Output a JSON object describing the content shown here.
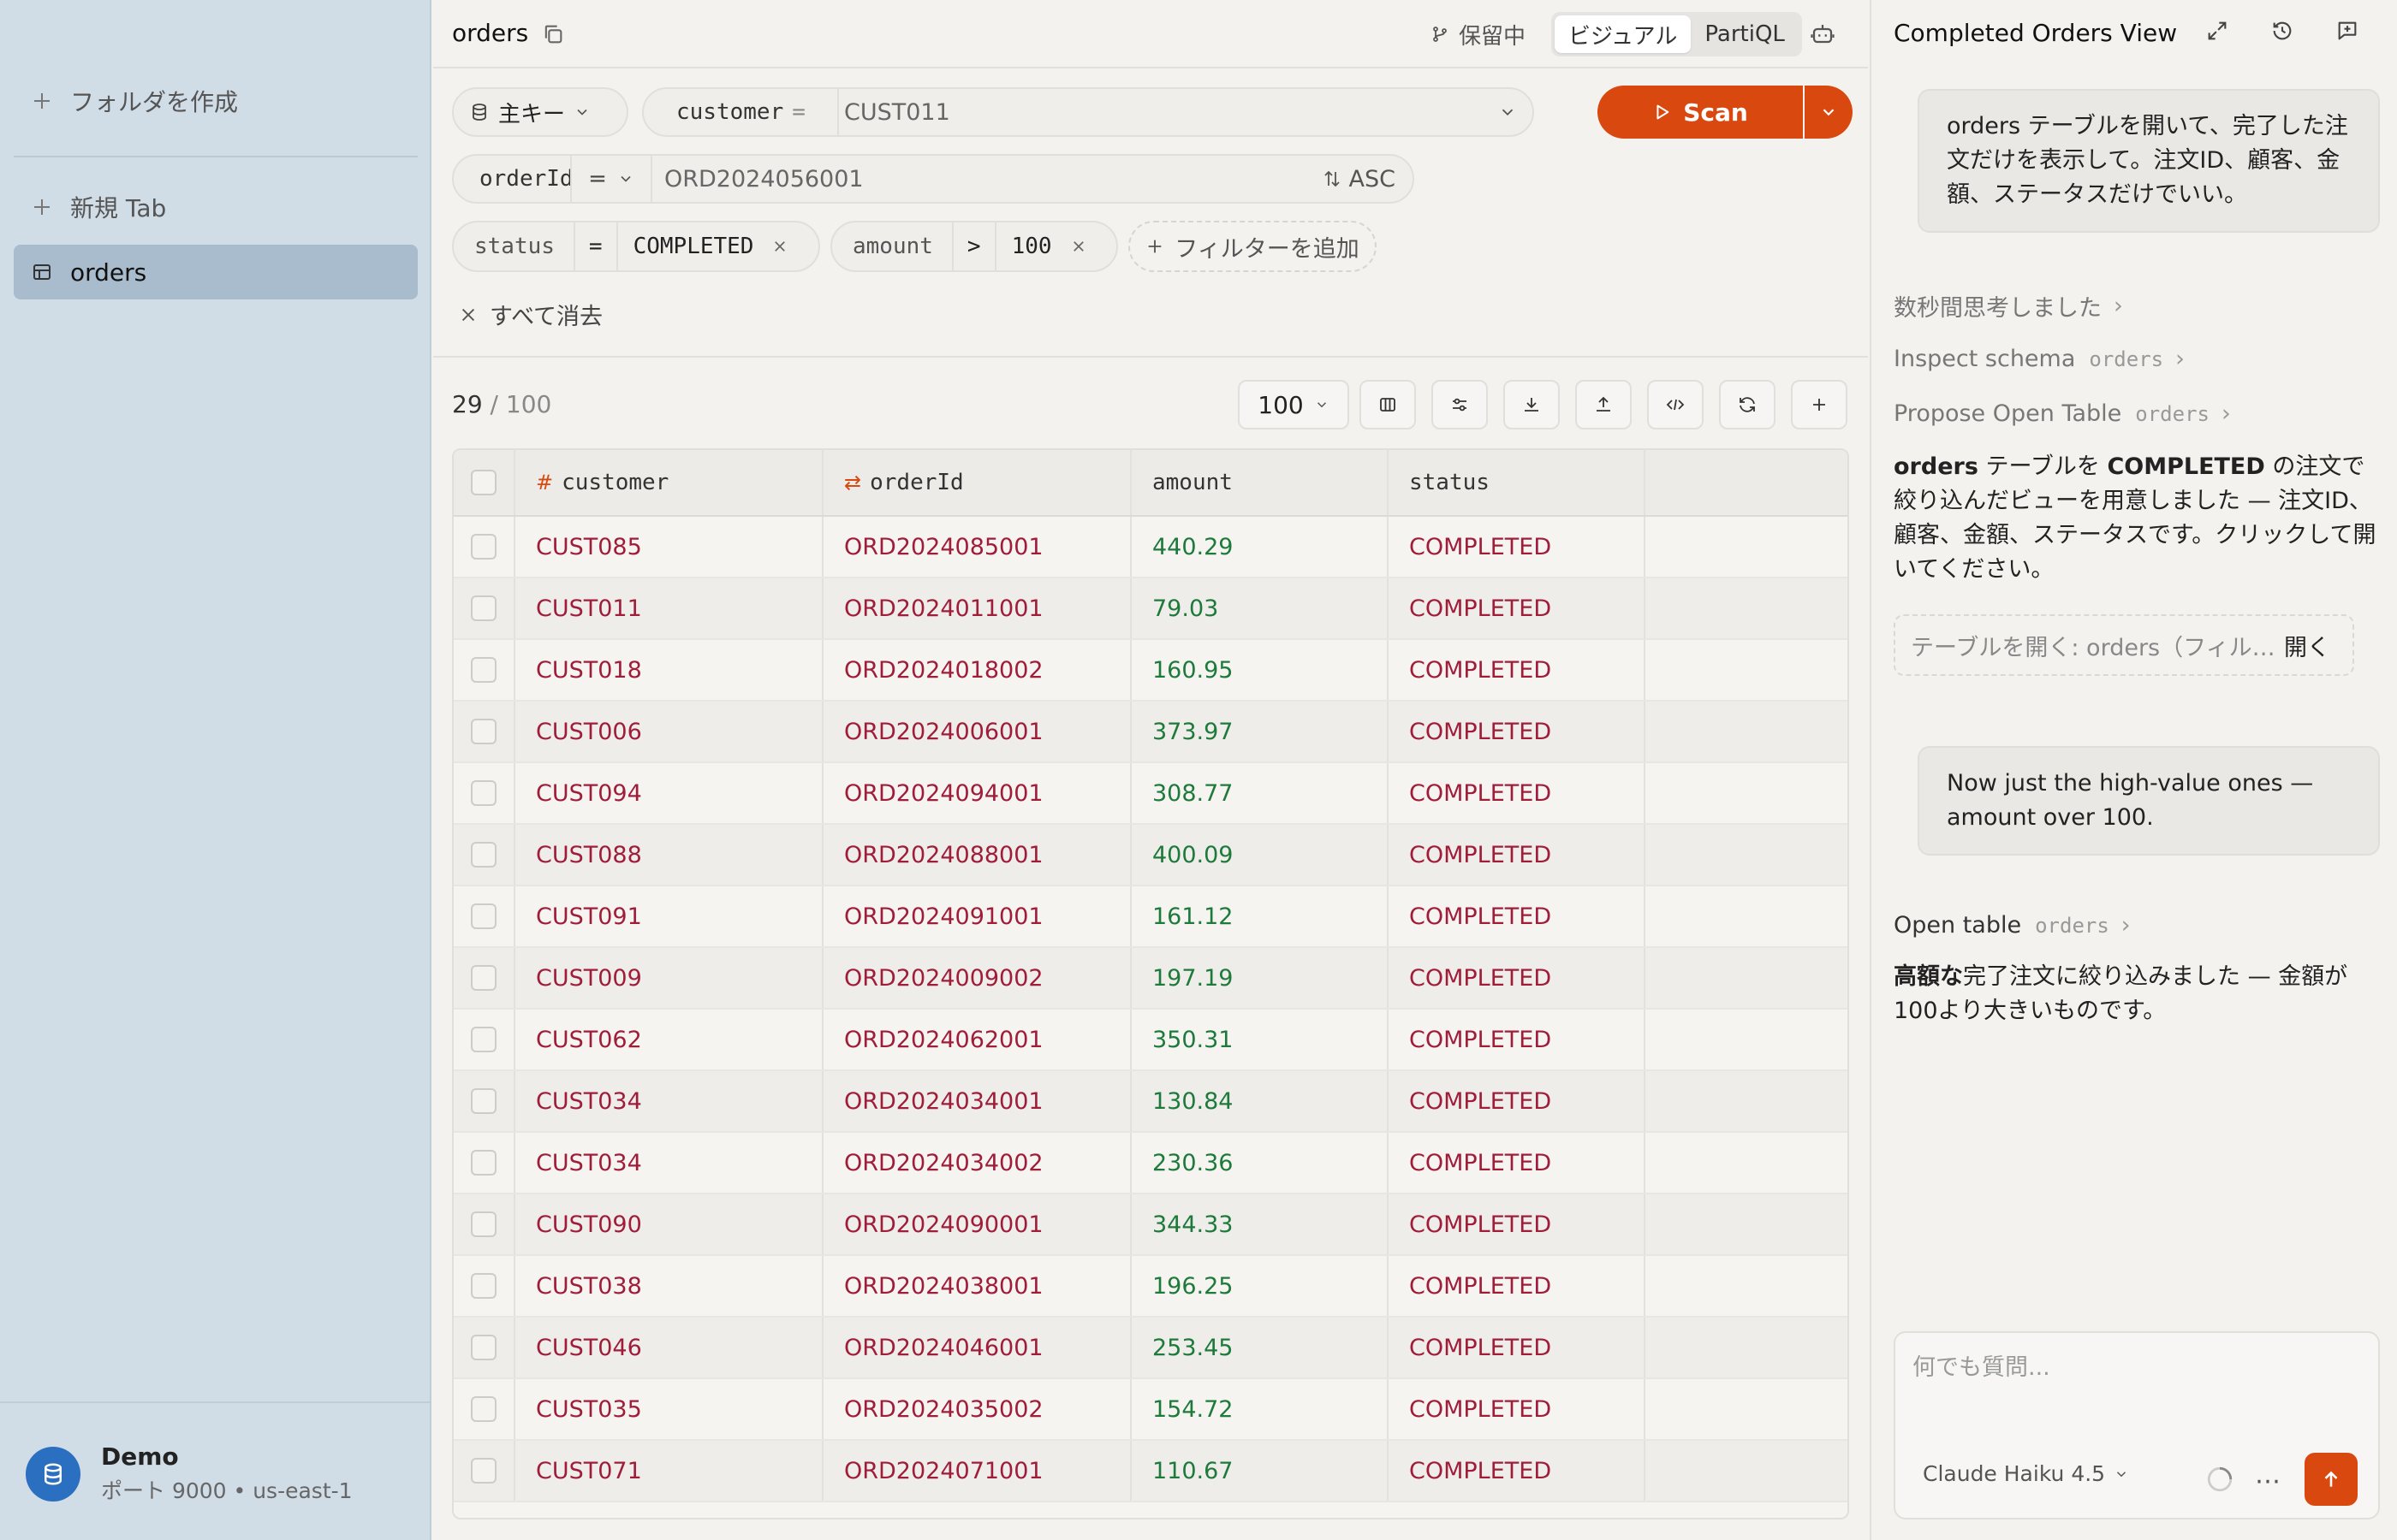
{
  "sidebar": {
    "create_folder": "フォルダを作成",
    "new_tab": "新規 Tab",
    "items": [
      {
        "label": "orders",
        "icon": "table-icon"
      }
    ],
    "connection": {
      "name": "Demo",
      "detail": "ポート 9000 • us-east-1"
    }
  },
  "header": {
    "tab_title": "orders",
    "branch_status": "保留中",
    "modes": [
      "ビジュアル",
      "PartiQL"
    ]
  },
  "query": {
    "key_selector": "主キー",
    "partition_key": "customer",
    "partition_op": "=",
    "partition_value": "CUST011",
    "sort_key": "orderId",
    "sort_op": "=",
    "sort_value": "ORD2024056001",
    "sort_order": "ASC",
    "scan_label": "Scan",
    "filters": [
      {
        "key": "status",
        "op": "=",
        "value": "COMPLETED"
      },
      {
        "key": "amount",
        "op": ">",
        "value": "100"
      }
    ],
    "add_filter": "フィルターを追加",
    "clear_all": "すべて消去"
  },
  "results": {
    "count": "29",
    "total": "/ 100",
    "page_size": "100"
  },
  "table": {
    "columns": [
      "customer",
      "orderId",
      "amount",
      "status"
    ],
    "rows": [
      [
        "CUST085",
        "ORD2024085001",
        "440.29",
        "COMPLETED"
      ],
      [
        "CUST011",
        "ORD2024011001",
        "79.03",
        "COMPLETED"
      ],
      [
        "CUST018",
        "ORD2024018002",
        "160.95",
        "COMPLETED"
      ],
      [
        "CUST006",
        "ORD2024006001",
        "373.97",
        "COMPLETED"
      ],
      [
        "CUST094",
        "ORD2024094001",
        "308.77",
        "COMPLETED"
      ],
      [
        "CUST088",
        "ORD2024088001",
        "400.09",
        "COMPLETED"
      ],
      [
        "CUST091",
        "ORD2024091001",
        "161.12",
        "COMPLETED"
      ],
      [
        "CUST009",
        "ORD2024009002",
        "197.19",
        "COMPLETED"
      ],
      [
        "CUST062",
        "ORD2024062001",
        "350.31",
        "COMPLETED"
      ],
      [
        "CUST034",
        "ORD2024034001",
        "130.84",
        "COMPLETED"
      ],
      [
        "CUST034",
        "ORD2024034002",
        "230.36",
        "COMPLETED"
      ],
      [
        "CUST090",
        "ORD2024090001",
        "344.33",
        "COMPLETED"
      ],
      [
        "CUST038",
        "ORD2024038001",
        "196.25",
        "COMPLETED"
      ],
      [
        "CUST046",
        "ORD2024046001",
        "253.45",
        "COMPLETED"
      ],
      [
        "CUST035",
        "ORD2024035002",
        "154.72",
        "COMPLETED"
      ],
      [
        "CUST071",
        "ORD2024071001",
        "110.67",
        "COMPLETED"
      ]
    ]
  },
  "assistant": {
    "title": "Completed Orders View",
    "user_msg_1": "orders テーブルを開いて、完了した注文だけを表示して。注文ID、顧客、金額、ステータスだけでいい。",
    "thinking": "数秒間思考しました",
    "step_1": "Inspect schema",
    "step_1_arg": "orders",
    "step_2": "Propose Open Table",
    "step_2_arg": "orders",
    "answer_1_bold1": "orders",
    "answer_1_a": " テーブルを ",
    "answer_1_bold2": "COMPLETED",
    "answer_1_b": " の注文で絞り込んだビューを用意しました — 注文ID、顧客、金額、ステータスです。クリックして開いてください。",
    "open_box_text": "テーブルを開く: orders（フィル…",
    "open_box_button": "開く",
    "user_msg_2": "Now just the high-value ones — amount over 100.",
    "step_3": "Open table",
    "step_3_arg": "orders",
    "answer_2_bold": "高額な",
    "answer_2_rest": "完了注文に絞り込みました — 金額が100より大きいものです。",
    "input_placeholder": "何でも質問...",
    "model": "Claude Haiku 4.5"
  }
}
